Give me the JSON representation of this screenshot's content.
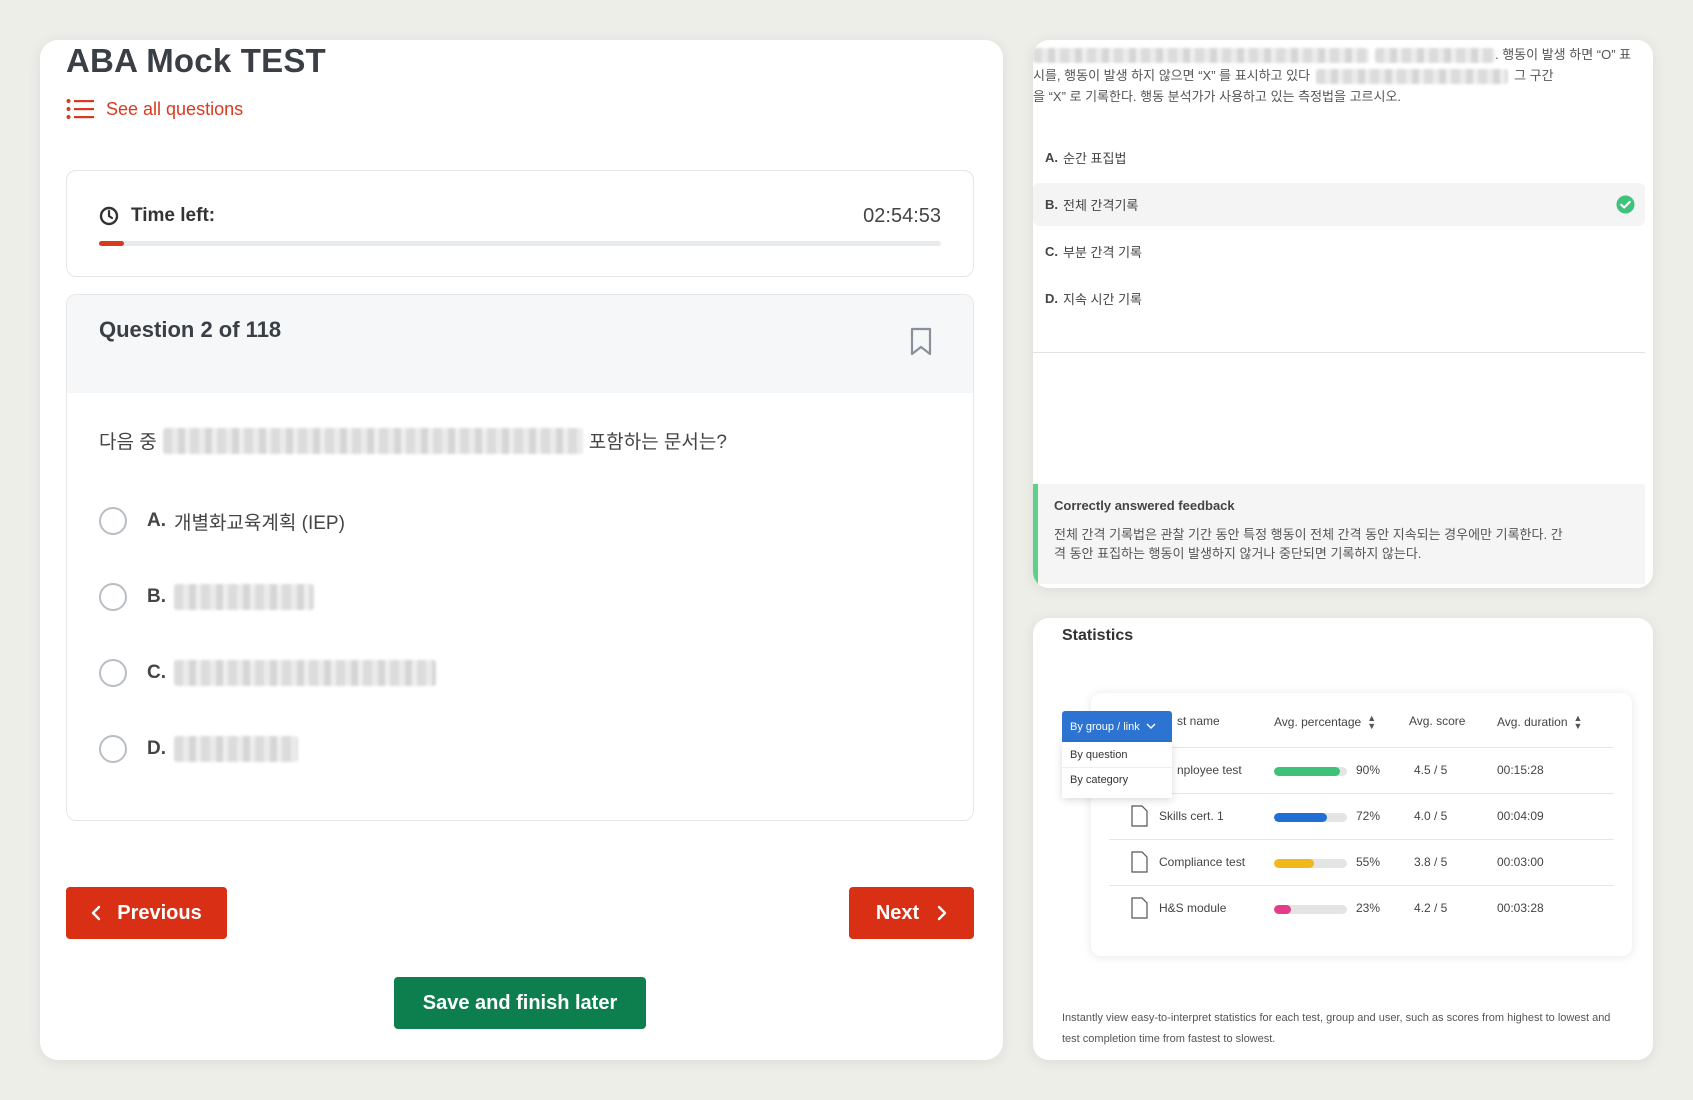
{
  "quiz": {
    "title": "ABA Mock TEST",
    "see_all_label": "See all questions",
    "time_left_label": "Time left:",
    "time_left_value": "02:54:53",
    "progress_fraction": 0.03,
    "question_number": "Question 2 of 118",
    "question_prefix": "다음 중",
    "question_suffix": "포함하는 문서는?",
    "options": [
      {
        "letter": "A.",
        "text": "개별화교육계획 (IEP)"
      },
      {
        "letter": "B.",
        "text": ""
      },
      {
        "letter": "C.",
        "text": ""
      },
      {
        "letter": "D.",
        "text": ""
      }
    ],
    "prev_label": "Previous",
    "next_label": "Next",
    "save_label": "Save and finish later"
  },
  "answer_panel": {
    "passage_line1_tail": ". 행동이 발생 하면 “O” 표",
    "passage_line2_head": "시를, 행동이 발생 하지 않으면 “X” 를 표시하고 있다",
    "passage_line2_tail": "그 구간",
    "passage_line3": "을 “X” 로 기록한다. 행동 분석가가 사용하고 있는 측정법을 고르시오.",
    "options": [
      {
        "letter": "A.",
        "text": "순간 표집법"
      },
      {
        "letter": "B.",
        "text": "전체 간격기록"
      },
      {
        "letter": "C.",
        "text": "부분 간격 기록"
      },
      {
        "letter": "D.",
        "text": "지속 시간 기록"
      }
    ],
    "selected_index": 1,
    "feedback_title": "Correctly answered feedback",
    "feedback_line1": "전체 간격 기록법은 관찰 기간 동안 특정 행동이 전체 간격 동안 지속되는 경우에만 기록한다. 간",
    "feedback_line2": "격 동안 표집하는 행동이 발생하지 않거나 중단되면 기록하지 않는다."
  },
  "statistics": {
    "title": "Statistics",
    "dropdown_selected": "By group / link",
    "dropdown_options": [
      "By question",
      "By category"
    ],
    "columns": [
      "st name",
      "Avg. percentage",
      "Avg. score",
      "Avg. duration"
    ],
    "rows": [
      {
        "name": "nployee test",
        "percent": 90,
        "percent_label": "90%",
        "score": "4.5 / 5",
        "duration": "00:15:28",
        "color": "#3ec27a"
      },
      {
        "name": "Skills cert. 1",
        "percent": 72,
        "percent_label": "72%",
        "score": "4.0 / 5",
        "duration": "00:04:09",
        "color": "#1f6fd6"
      },
      {
        "name": "Compliance test",
        "percent": 55,
        "percent_label": "55%",
        "score": "3.8 / 5",
        "duration": "00:03:00",
        "color": "#f0b81c"
      },
      {
        "name": "H&S module",
        "percent": 23,
        "percent_label": "23%",
        "score": "4.2 / 5",
        "duration": "00:03:28",
        "color": "#e23c8a"
      }
    ],
    "caption_line1": "Instantly view easy-to-interpret statistics for each test, group and user, such as scores from highest to lowest and",
    "caption_line2": "test completion time from fastest to slowest."
  },
  "colors": {
    "accent_red": "#d93015",
    "save_green": "#0d7f4f",
    "feedback_green": "#5fd08c",
    "dropdown_blue": "#2d74d2"
  },
  "icons": {
    "see_all": "list-icon",
    "timer": "clock-icon",
    "bookmark": "bookmark-icon",
    "prev": "chevron-left-icon",
    "next": "chevron-right-icon",
    "correct": "check-circle-icon",
    "row": "document-icon",
    "dropdown": "chevron-down-icon"
  }
}
